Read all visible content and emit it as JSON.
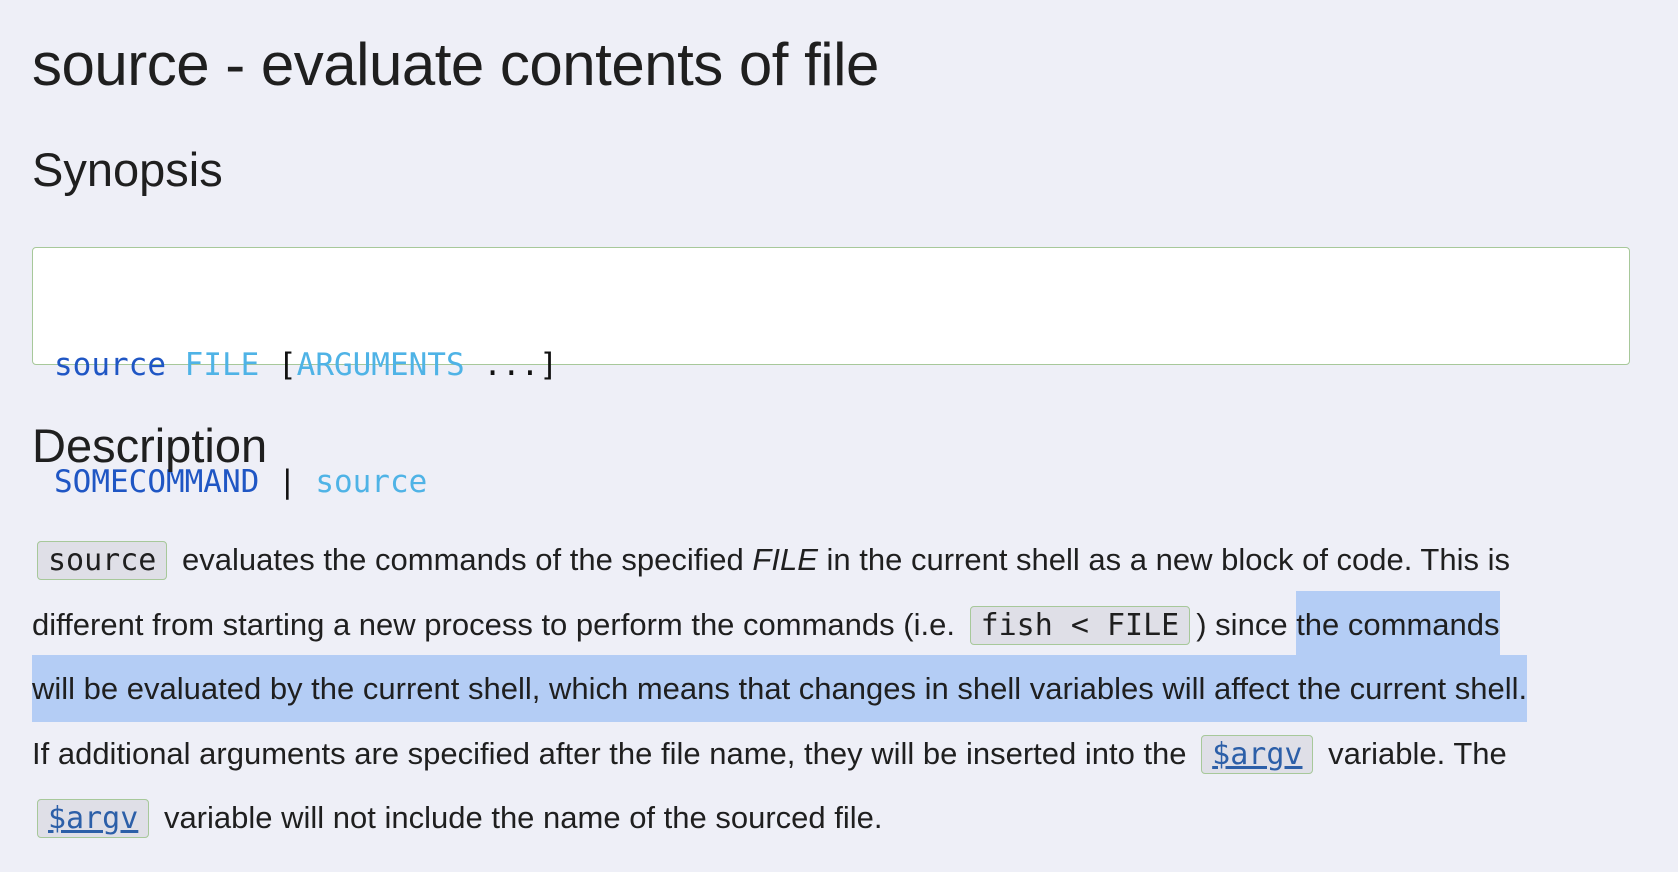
{
  "title": "source - evaluate contents of file",
  "synopsis": {
    "heading": "Synopsis",
    "line1": {
      "cmd": "source",
      "file": "FILE",
      "bracket_open": "[",
      "args": "ARGUMENTS",
      "tail": " ...]"
    },
    "line2": {
      "cmd": "SOMECOMMAND",
      "pipe": " | ",
      "source": "source"
    }
  },
  "description": {
    "heading": "Description",
    "code_source": "source",
    "t1": "evaluates the commands of the specified",
    "file_em": "FILE",
    "t2": "in the current shell as a new block of code. This is",
    "t3": "different from starting a new process to perform the commands (i.e.",
    "code_fish": "fish < FILE",
    "t4": ") since",
    "hl1": "the commands",
    "hl2": "will be evaluated by the current shell, which means that changes in shell variables will affect the current shell.",
    "t5": "If additional arguments are specified after the file name, they will be inserted into the",
    "argv_link_1": "$argv",
    "t6": "variable. The",
    "argv_link_2": "$argv",
    "t7": "variable will not include the name of the sourced file."
  },
  "colors": {
    "background": "#eeeff7",
    "keyword": "#1f56c4",
    "argument": "#4fb3e6",
    "highlight": "#b4cdf5",
    "code_border": "#a7c89a",
    "link": "#2c5fa8"
  }
}
